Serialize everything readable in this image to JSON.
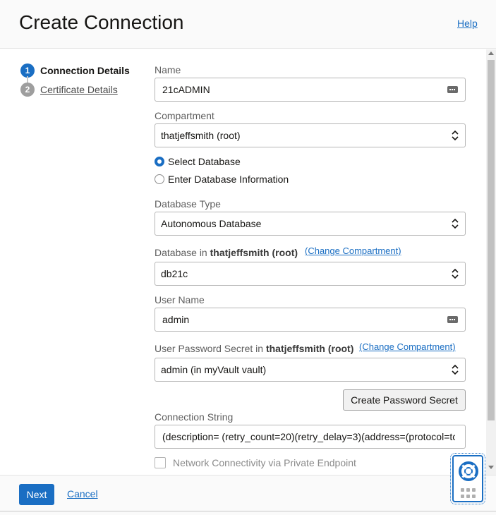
{
  "header": {
    "title": "Create Connection",
    "help_link": "Help"
  },
  "steps": [
    {
      "number": "1",
      "label": "Connection Details",
      "active": true
    },
    {
      "number": "2",
      "label": "Certificate Details",
      "active": false
    }
  ],
  "form": {
    "name": {
      "label": "Name",
      "value": "21cADMIN"
    },
    "compartment": {
      "label": "Compartment",
      "value": "thatjeffsmith (root)"
    },
    "database_source": {
      "options": [
        "Select Database",
        "Enter Database Information"
      ],
      "selected": "Select Database"
    },
    "database_type": {
      "label": "Database Type",
      "value": "Autonomous Database"
    },
    "database": {
      "label_prefix": "Database in ",
      "label_bold": "thatjeffsmith (root)",
      "change_link": "(Change Compartment)",
      "value": "db21c"
    },
    "user_name": {
      "label": "User Name",
      "value": "admin"
    },
    "password_secret": {
      "label_prefix": "User Password Secret in ",
      "label_bold": "thatjeffsmith (root)",
      "change_link": "(Change Compartment)",
      "value": "admin (in myVault vault)"
    },
    "create_secret_button": "Create Password Secret",
    "connection_string": {
      "label": "Connection String",
      "value": "(description= (retry_count=20)(retry_delay=3)(address=(protocol=tc"
    },
    "private_endpoint": {
      "label": "Network Connectivity via Private Endpoint",
      "checked": false
    }
  },
  "footer": {
    "next_label": "Next",
    "cancel_label": "Cancel"
  },
  "help_widget": {
    "icon": "lifebuoy-icon",
    "grip": "grid-dots-icon"
  },
  "colors": {
    "accent": "#1a6ec3",
    "text": "#161513",
    "muted": "#5e5e5e"
  }
}
